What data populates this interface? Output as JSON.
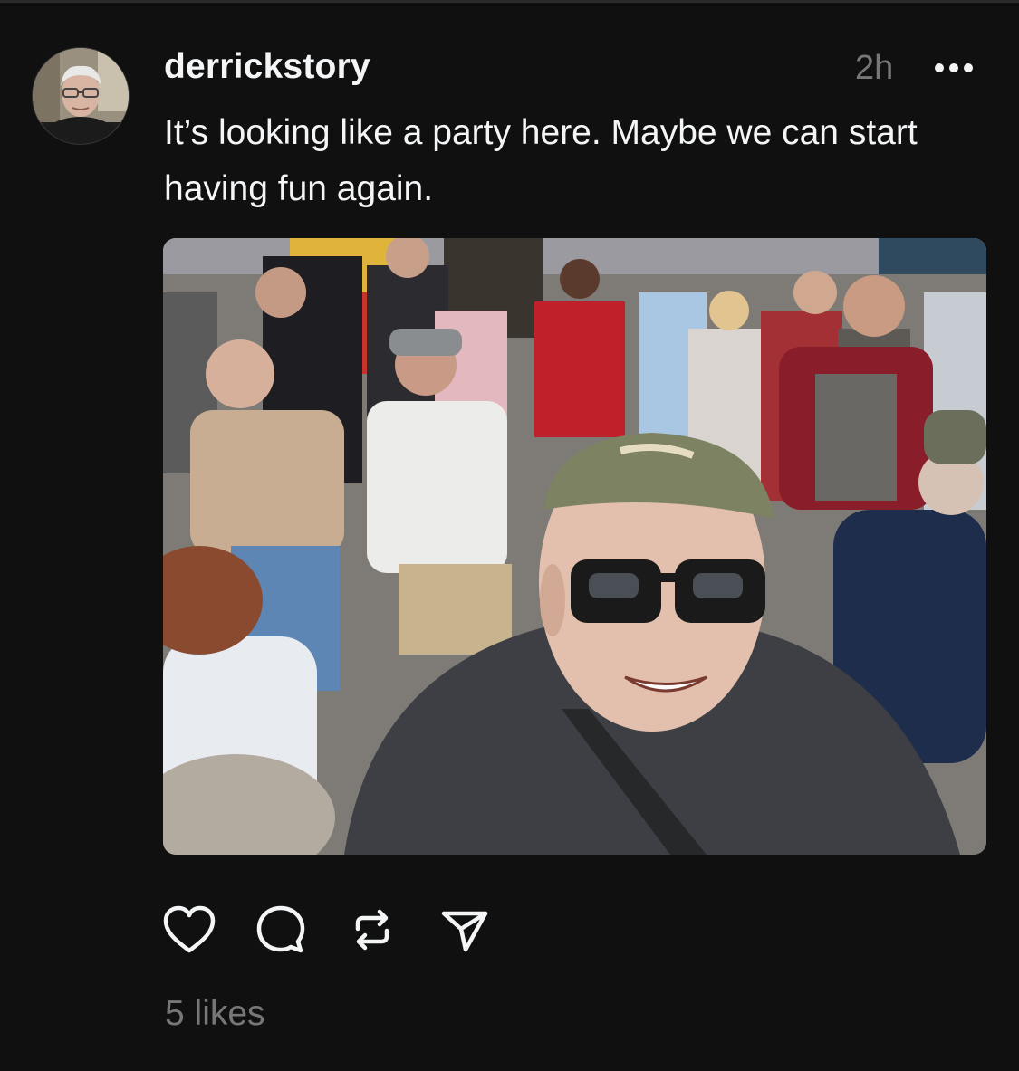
{
  "post": {
    "username": "derrickstory",
    "timestamp": "2h",
    "caption": "It’s looking like a party here. Maybe we can start having fun again.",
    "likes_text": "5 likes"
  },
  "icons": {
    "avatar": "profile-photo",
    "more": "more-horizontal-icon",
    "like": "heart-icon",
    "comment": "speech-bubble-icon",
    "repost": "repost-icon",
    "share": "paper-plane-icon"
  },
  "colors": {
    "background": "#101010",
    "primary_text": "#f3f5f7",
    "secondary_text": "#777777"
  }
}
